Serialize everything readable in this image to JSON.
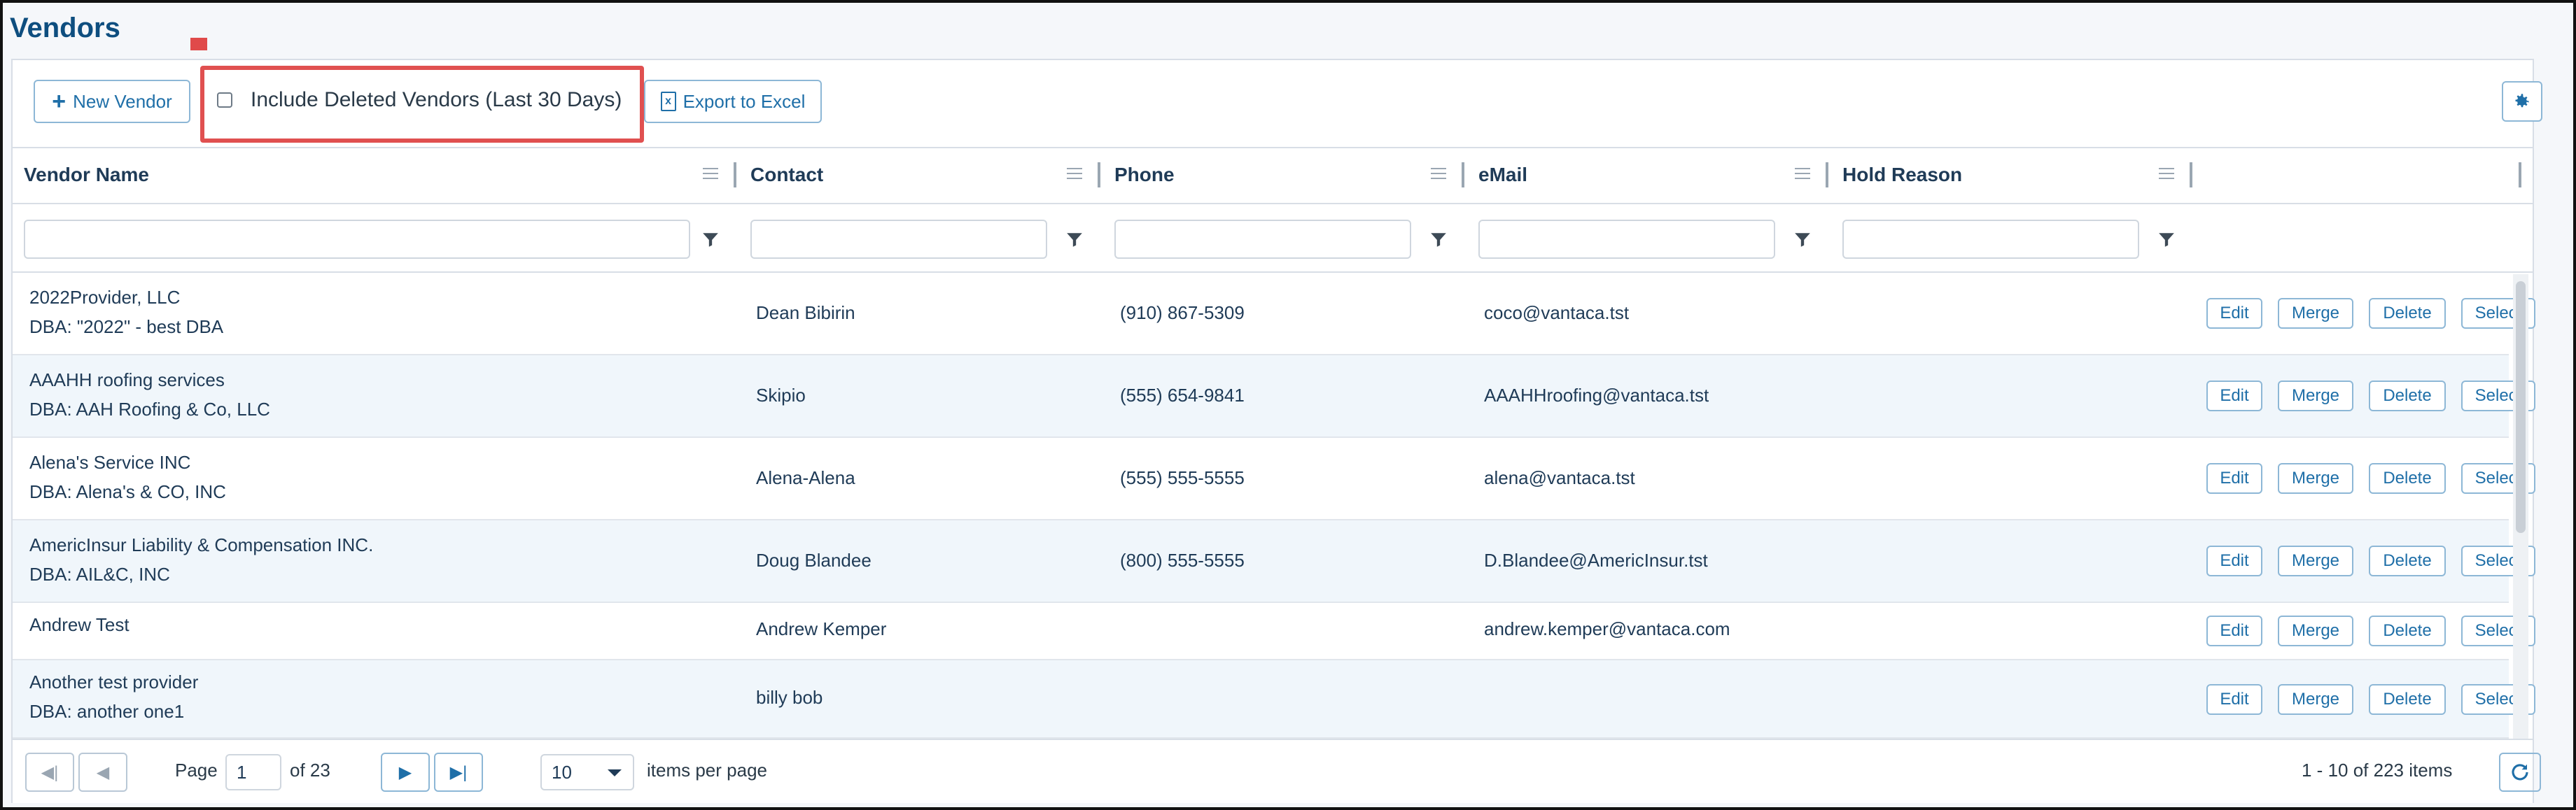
{
  "page": {
    "title": "Vendors"
  },
  "toolbar": {
    "new_vendor_label": "New Vendor",
    "include_deleted_label": "Include Deleted Vendors (Last 30 Days)",
    "export_label": "Export to Excel"
  },
  "columns": [
    "Vendor Name",
    "Contact",
    "Phone",
    "eMail",
    "Hold Reason"
  ],
  "row_actions": [
    "Edit",
    "Merge",
    "Delete",
    "Select"
  ],
  "rows": [
    {
      "name": "2022Provider, LLC",
      "dba": "DBA: \"2022\" - best DBA",
      "contact": "Dean Bibirin",
      "phone": "(910) 867-5309",
      "email": "coco@vantaca.tst",
      "hold": ""
    },
    {
      "name": "AAAHH roofing services",
      "dba": "DBA: AAH Roofing & Co, LLC",
      "contact": "Skipio",
      "phone": "(555) 654-9841",
      "email": "AAAHHroofing@vantaca.tst",
      "hold": ""
    },
    {
      "name": "Alena's Service INC",
      "dba": "DBA: Alena's & CO, INC",
      "contact": "Alena-Alena",
      "phone": "(555) 555-5555",
      "email": "alena@vantaca.tst",
      "hold": ""
    },
    {
      "name": "AmericInsur Liability & Compensation INC.",
      "dba": "DBA: AIL&C, INC",
      "contact": "Doug Blandee",
      "phone": "(800) 555-5555",
      "email": "D.Blandee@AmericInsur.tst",
      "hold": ""
    },
    {
      "name": "Andrew Test",
      "dba": "",
      "contact": "Andrew Kemper",
      "phone": "",
      "email": "andrew.kemper@vantaca.com",
      "hold": ""
    },
    {
      "name": "Another test provider",
      "dba": "DBA: another one1",
      "contact": "billy bob",
      "phone": "",
      "email": "",
      "hold": ""
    }
  ],
  "pager": {
    "page_label": "Page",
    "current_page": "1",
    "of_label": "of 23",
    "page_size": "10",
    "items_per_page_label": "items per page",
    "summary": "1 - 10 of 223 items"
  },
  "icons": {
    "plus": "plus-icon",
    "excel": "excel-icon",
    "gear": "gear-icon",
    "menu": "menu-icon",
    "filter": "filter-icon",
    "first": "first-page-icon",
    "prev": "prev-page-icon",
    "next": "next-page-icon",
    "last": "last-page-icon",
    "refresh": "refresh-icon",
    "caret": "caret-down-icon"
  },
  "colors": {
    "accent": "#1f6fa8",
    "title": "#0e4e7f",
    "highlight": "#e05050",
    "row_alt": "#f0f6fb"
  }
}
